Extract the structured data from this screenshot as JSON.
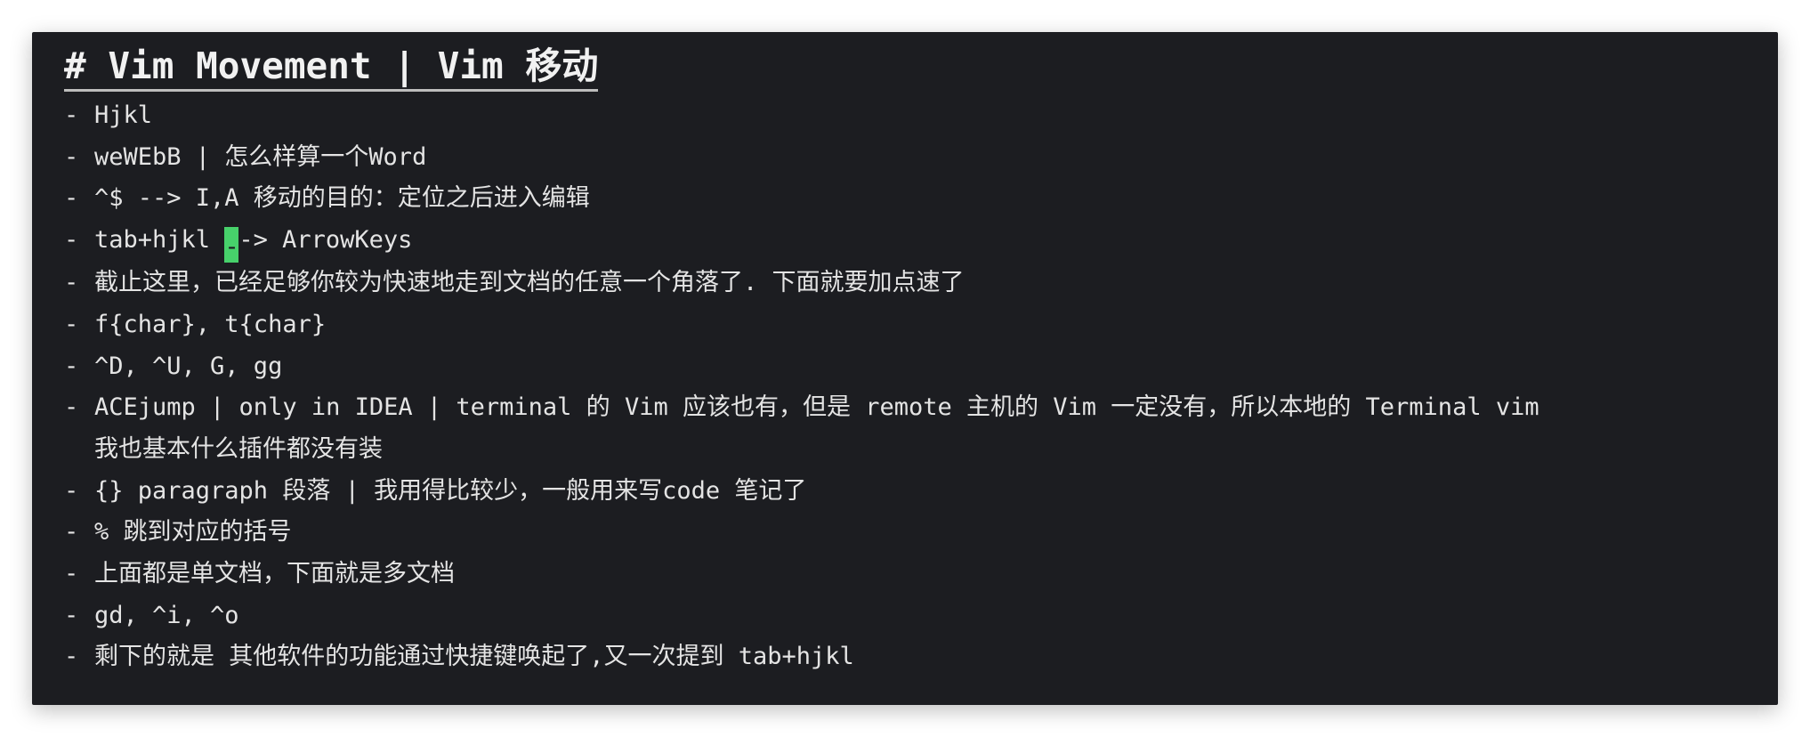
{
  "note": {
    "heading": "# Vim Movement | Vim 移动",
    "bullet": "-",
    "lines": [
      {
        "text": "Hjkl"
      },
      {
        "text": "weWEbB | 怎么样算一个Word"
      },
      {
        "text": "^$ --> I,A 移动的目的：定位之后进入编辑"
      },
      {
        "before_cursor": "tab+hjkl ",
        "cursor_char": "-",
        "after_cursor": "-> ArrowKeys"
      },
      {
        "text": "截止这里，已经足够你较为快速地走到文档的任意一个角落了. 下面就要加点速了"
      },
      {
        "text": "f{char}, t{char}"
      },
      {
        "text": "^D, ^U, G, gg"
      },
      {
        "text": "ACEjump | only in IDEA | terminal 的 Vim 应该也有，但是 remote 主机的 Vim 一定没有，所以本地的 Terminal vim",
        "continuation": "我也基本什么插件都没有装"
      },
      {
        "text": "{} paragraph 段落 | 我用得比较少，一般用来写code 笔记了"
      },
      {
        "text": "% 跳到对应的括号"
      },
      {
        "text": "上面都是单文档，下面就是多文档"
      },
      {
        "text": "gd, ^i, ^o"
      },
      {
        "text": "剩下的就是 其他软件的功能通过快捷键唤起了,又一次提到 tab+hjkl"
      }
    ]
  },
  "colors": {
    "background": "#1c1d21",
    "text": "#e4e4e4",
    "cursor": "#47d16b"
  }
}
